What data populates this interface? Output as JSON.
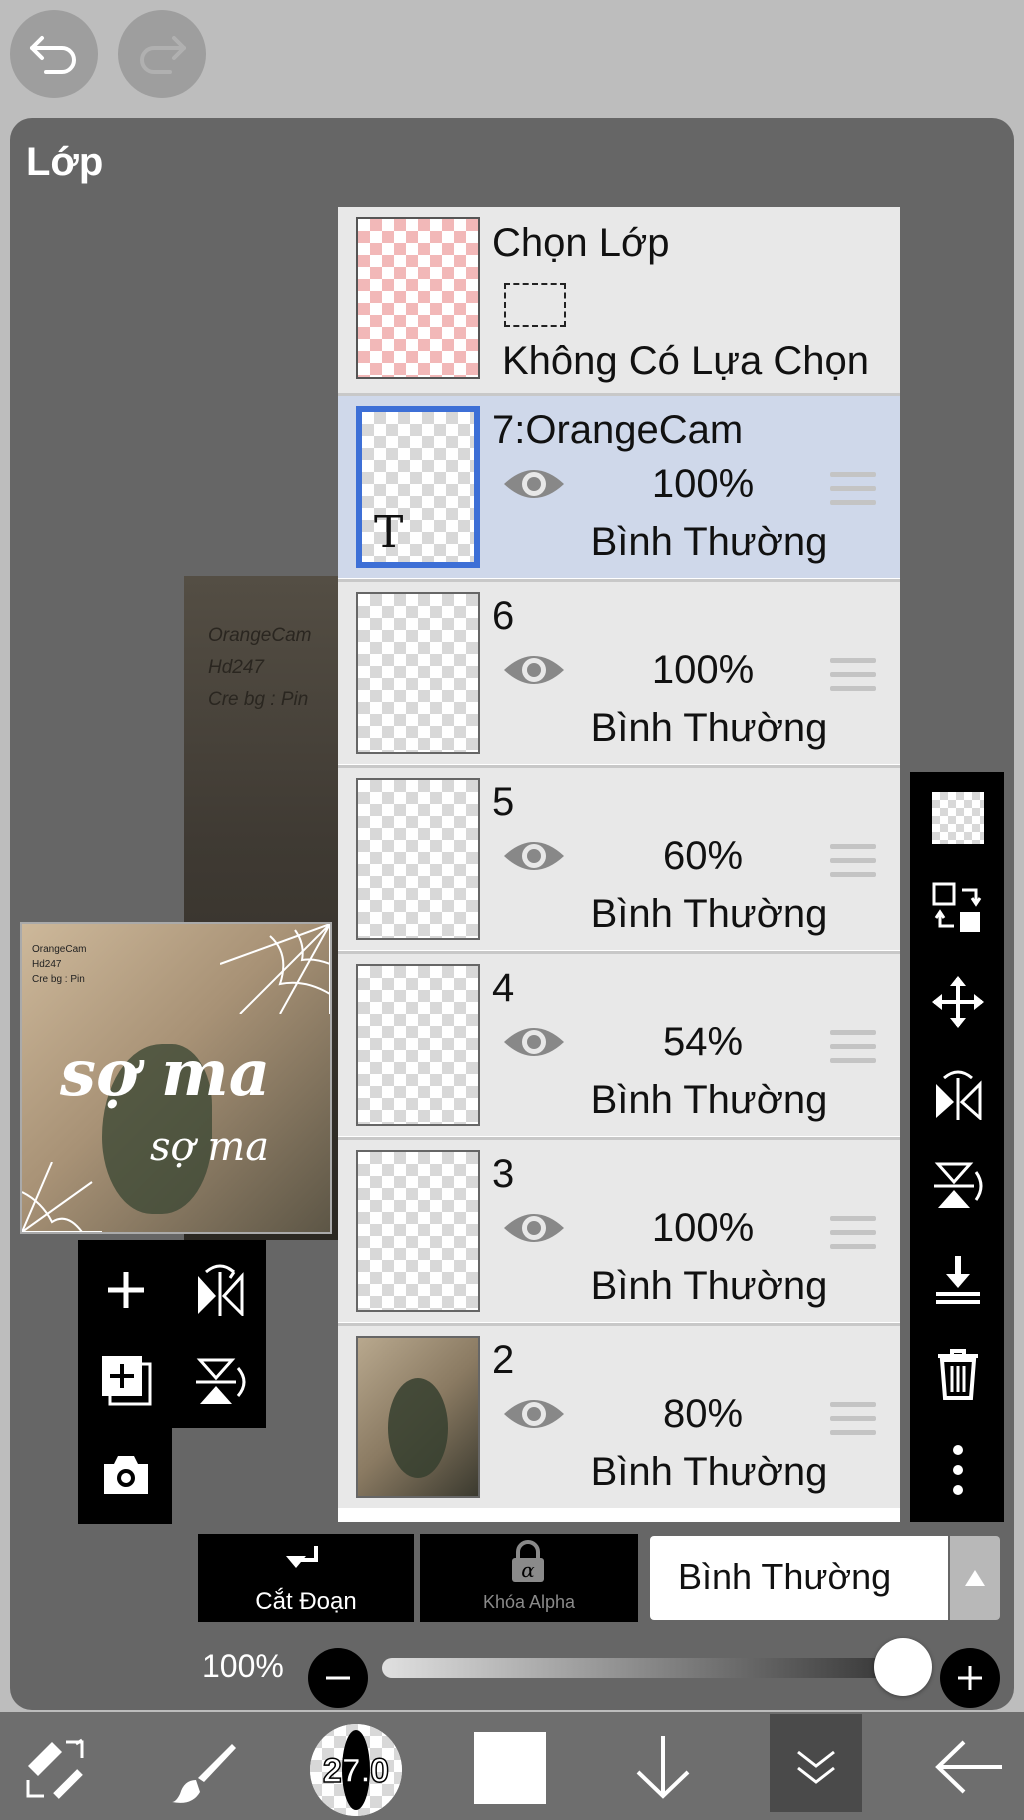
{
  "panel": {
    "title": "Lớp"
  },
  "selection_layer": {
    "title": "Chọn Lớp",
    "status": "Không Có Lựa Chọn"
  },
  "layers": [
    {
      "name": "7:OrangeCam",
      "opacity": "100%",
      "blend": "Bình Thường",
      "active": true,
      "type": "text",
      "thumb_letter": "T"
    },
    {
      "name": "6",
      "opacity": "100%",
      "blend": "Bình Thường",
      "active": false
    },
    {
      "name": "5",
      "opacity": "60%",
      "blend": "Bình Thường",
      "active": false
    },
    {
      "name": "4",
      "opacity": "54%",
      "blend": "Bình Thường",
      "active": false
    },
    {
      "name": "3",
      "opacity": "100%",
      "blend": "Bình Thường",
      "active": false
    },
    {
      "name": "2",
      "opacity": "80%",
      "blend": "Bình Thường",
      "active": false
    }
  ],
  "canvas_preview": {
    "credits": [
      "OrangeCam",
      "Hd247",
      "Cre bg : Pin"
    ],
    "big_text": "sợ ma",
    "small_text": "sợ ma"
  },
  "bottom_controls": {
    "clip_label": "Cắt Đoạn",
    "alpha_lock_label": "Khóa Alpha",
    "blend_mode": "Bình Thường",
    "opacity_value": "100%",
    "opacity_fraction": 1.0
  },
  "toolbar": {
    "brush_size": "27.0"
  },
  "colors": {
    "accent": "#3d6fd6",
    "active_row": "#cfd8ea",
    "panel": "#666666"
  }
}
